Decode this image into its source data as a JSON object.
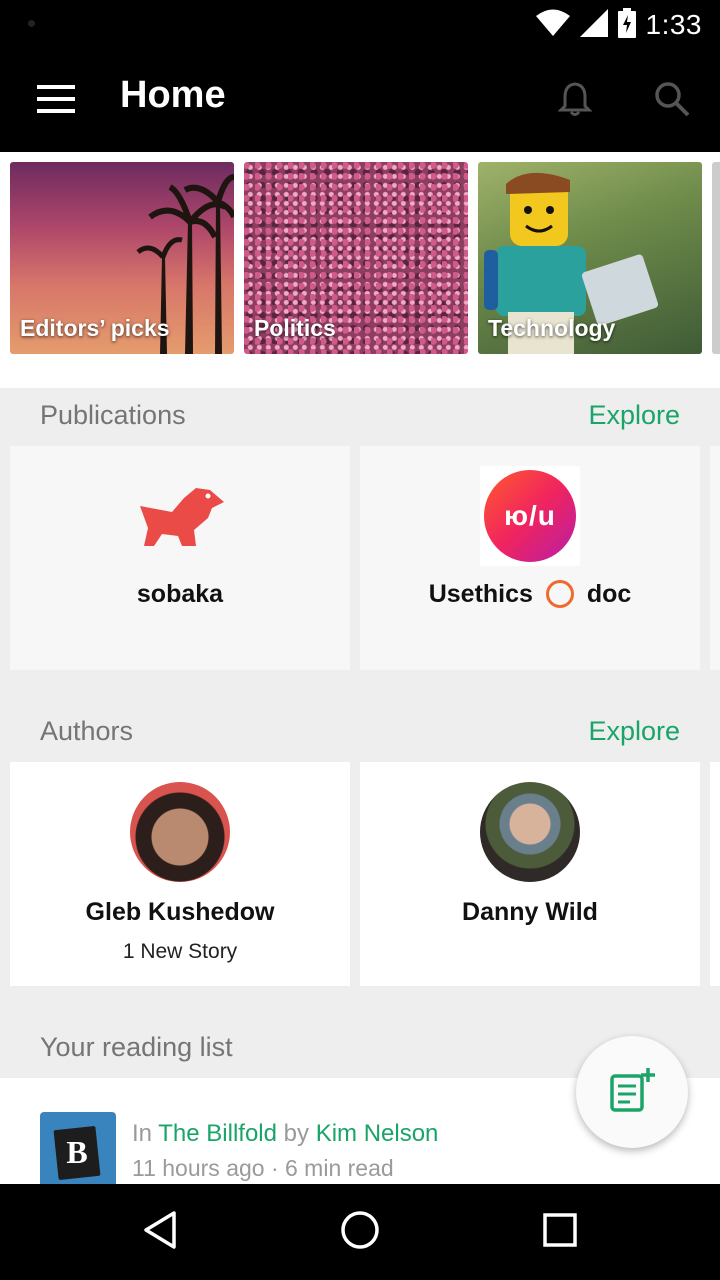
{
  "status_bar": {
    "time": "1:33"
  },
  "app_bar": {
    "title": "Home"
  },
  "topics": [
    {
      "label": "Editors’ picks"
    },
    {
      "label": "Politics"
    },
    {
      "label": "Technology"
    }
  ],
  "publications": {
    "title": "Publications",
    "explore_label": "Explore",
    "items": [
      {
        "name": "sobaka"
      },
      {
        "name_part1": "Usethics",
        "name_part2": "doc",
        "logo_text": "ю/u"
      }
    ]
  },
  "authors": {
    "title": "Authors",
    "explore_label": "Explore",
    "items": [
      {
        "name": "Gleb Kushedow",
        "subtitle": "1 New Story"
      },
      {
        "name": "Danny Wild"
      }
    ]
  },
  "reading_list": {
    "title": "Your reading list",
    "item": {
      "prefix_in": "In",
      "publication": "The Billfold",
      "by": "by",
      "author": "Kim Nelson",
      "time": "11 hours ago · 6 min read",
      "thumb_letter": "B"
    }
  },
  "colors": {
    "accent": "#1aa468",
    "bar": "#000000",
    "background": "#eeeeee"
  },
  "icons": [
    "hamburger-menu-icon",
    "bell-icon",
    "search-icon",
    "compose-icon",
    "back-icon",
    "home-icon",
    "recents-icon",
    "wifi-icon",
    "signal-icon",
    "battery-icon"
  ]
}
